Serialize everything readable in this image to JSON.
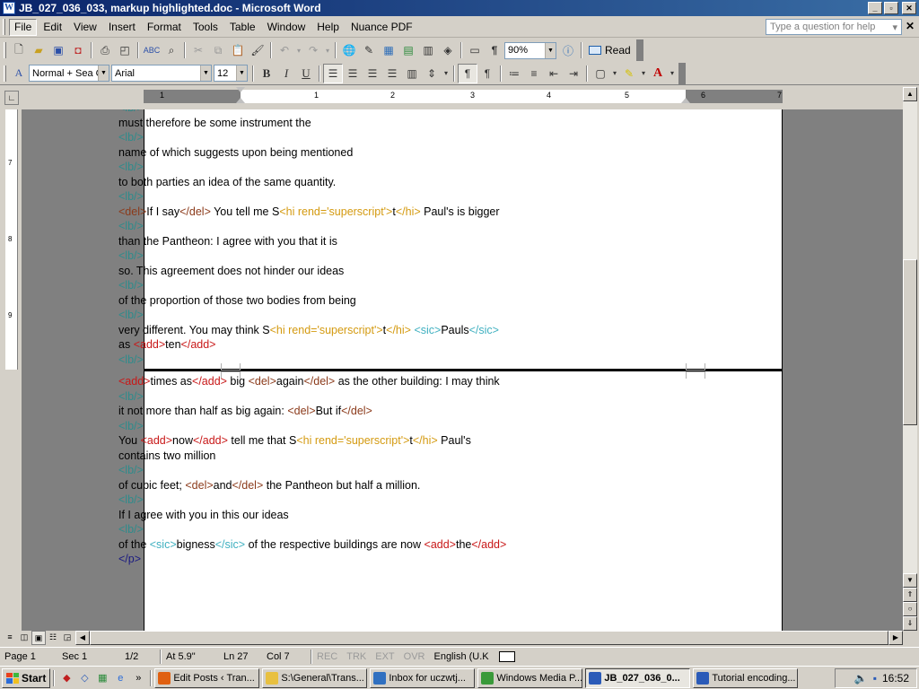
{
  "window": {
    "title": "JB_027_036_033, markup highlighted.doc - Microsoft Word"
  },
  "menu": {
    "items": [
      "File",
      "Edit",
      "View",
      "Insert",
      "Format",
      "Tools",
      "Table",
      "Window",
      "Help",
      "Nuance PDF"
    ],
    "help_placeholder": "Type a question for help"
  },
  "standard_toolbar": {
    "zoom": "90%",
    "read_label": "Read"
  },
  "format_toolbar": {
    "style": "Normal + Sea G",
    "font": "Arial",
    "size": "12"
  },
  "ruler": {
    "labels": [
      "1",
      "1",
      "2",
      "3",
      "4",
      "5",
      "6",
      "7"
    ],
    "left_labels": [
      "7",
      "8",
      "9"
    ]
  },
  "document": {
    "page1_lines": [
      [
        [
          "tag-lb",
          "<lb/>"
        ]
      ],
      [
        [
          "txt",
          "must therefore be some instrument the"
        ]
      ],
      [
        [
          "tag-lb",
          "<lb/>"
        ]
      ],
      [
        [
          "txt",
          "name of which suggests upon being mentioned"
        ]
      ],
      [
        [
          "tag-lb",
          "<lb/>"
        ]
      ],
      [
        [
          "txt",
          "to both parties an idea of the same quantity."
        ]
      ],
      [
        [
          "tag-lb",
          "<lb/>"
        ]
      ],
      [
        [
          "tag-del",
          "<del>"
        ],
        [
          "txt",
          "If I say"
        ],
        [
          "tag-del",
          "</del>"
        ],
        [
          "txt",
          " You tell me S"
        ],
        [
          "tag-hi",
          "<hi rend='superscript'>"
        ],
        [
          "txt",
          "t"
        ],
        [
          "tag-hi",
          "</hi>"
        ],
        [
          "txt",
          " Paul's is bigger"
        ]
      ],
      [
        [
          "tag-lb",
          "<lb/>"
        ]
      ],
      [
        [
          "txt",
          "than the Pantheon: I agree with you that it is"
        ]
      ],
      [
        [
          "tag-lb",
          "<lb/>"
        ]
      ],
      [
        [
          "txt",
          "so. This agreement does not hinder our ideas"
        ]
      ],
      [
        [
          "tag-lb",
          "<lb/>"
        ]
      ],
      [
        [
          "txt",
          "of the proportion of those two bodies from being"
        ]
      ],
      [
        [
          "tag-lb",
          "<lb/>"
        ]
      ],
      [
        [
          "txt",
          "very different. You may think S"
        ],
        [
          "tag-hi",
          "<hi rend='superscript'>"
        ],
        [
          "txt",
          "t"
        ],
        [
          "tag-hi",
          "</hi>"
        ],
        [
          "txt",
          " "
        ],
        [
          "tag-sic",
          "<sic>"
        ],
        [
          "txt",
          "Pauls"
        ],
        [
          "tag-sic",
          "</sic>"
        ]
      ],
      [
        [
          "txt",
          "as "
        ],
        [
          "tag-add",
          "<add>"
        ],
        [
          "txt",
          "ten"
        ],
        [
          "tag-add",
          "</add>"
        ]
      ],
      [
        [
          "tag-lb",
          "<lb/>"
        ]
      ]
    ],
    "page2_lines": [
      [
        [
          "tag-add",
          "<add>"
        ],
        [
          "txt",
          "times as"
        ],
        [
          "tag-add",
          "</add>"
        ],
        [
          "txt",
          " big "
        ],
        [
          "tag-del",
          "<del>"
        ],
        [
          "txt",
          "again"
        ],
        [
          "tag-del",
          "</del>"
        ],
        [
          "txt",
          " as the other building: I may think"
        ]
      ],
      [
        [
          "tag-lb",
          "<lb/>"
        ]
      ],
      [
        [
          "txt",
          "it not more than half as big again: "
        ],
        [
          "tag-del",
          "<del>"
        ],
        [
          "txt",
          "But if"
        ],
        [
          "tag-del",
          "</del>"
        ]
      ],
      [
        [
          "tag-lb",
          "<lb/>"
        ]
      ],
      [
        [
          "txt",
          "You "
        ],
        [
          "tag-add",
          "<add>"
        ],
        [
          "txt",
          "now"
        ],
        [
          "tag-add",
          "</add>"
        ],
        [
          "txt",
          " tell me that S"
        ],
        [
          "tag-hi",
          "<hi rend='superscript'>"
        ],
        [
          "txt",
          "t"
        ],
        [
          "tag-hi",
          "</hi>"
        ],
        [
          "txt",
          " Paul's"
        ]
      ],
      [
        [
          "txt",
          "contains two million"
        ]
      ],
      [
        [
          "tag-lb",
          "<lb/>"
        ]
      ],
      [
        [
          "txt",
          "of cubic feet; "
        ],
        [
          "tag-del",
          "<del>"
        ],
        [
          "txt",
          "and"
        ],
        [
          "tag-del",
          "</del>"
        ],
        [
          "txt",
          " the Pantheon but half a million."
        ]
      ],
      [
        [
          "tag-lb",
          "<lb/>"
        ]
      ],
      [
        [
          "txt",
          "If I agree with you in this our ideas"
        ]
      ],
      [
        [
          "tag-lb",
          "<lb/>"
        ]
      ],
      [
        [
          "txt",
          "of the "
        ],
        [
          "tag-sic",
          "<sic>"
        ],
        [
          "txt",
          "bigness"
        ],
        [
          "tag-sic",
          "</sic>"
        ],
        [
          "txt",
          " of the respective buildings are now "
        ],
        [
          "tag-add",
          "<add>"
        ],
        [
          "txt",
          "the"
        ],
        [
          "tag-add",
          "</add>"
        ]
      ],
      [
        [
          "tag-p",
          "</p>"
        ]
      ]
    ]
  },
  "status": {
    "page": "Page 1",
    "sec": "Sec 1",
    "pages": "1/2",
    "at": "At 5.9\"",
    "ln": "Ln 27",
    "col": "Col 7",
    "rec": "REC",
    "trk": "TRK",
    "ext": "EXT",
    "ovr": "OVR",
    "lang": "English (U.K"
  },
  "taskbar": {
    "start": "Start",
    "tasks": [
      {
        "label": "Edit Posts ‹ Tran...",
        "icon_color": "#e06010",
        "active": false
      },
      {
        "label": "S:\\General\\Trans...",
        "icon_color": "#e8c040",
        "active": false
      },
      {
        "label": "Inbox for uczwtj...",
        "icon_color": "#3070c0",
        "active": false
      },
      {
        "label": "Windows Media P...",
        "icon_color": "#3a9a3a",
        "active": false
      },
      {
        "label": "JB_027_036_0...",
        "icon_color": "#2b5bb8",
        "active": true
      },
      {
        "label": "Tutorial encoding...",
        "icon_color": "#2b5bb8",
        "active": false
      }
    ],
    "clock": "16:52"
  }
}
